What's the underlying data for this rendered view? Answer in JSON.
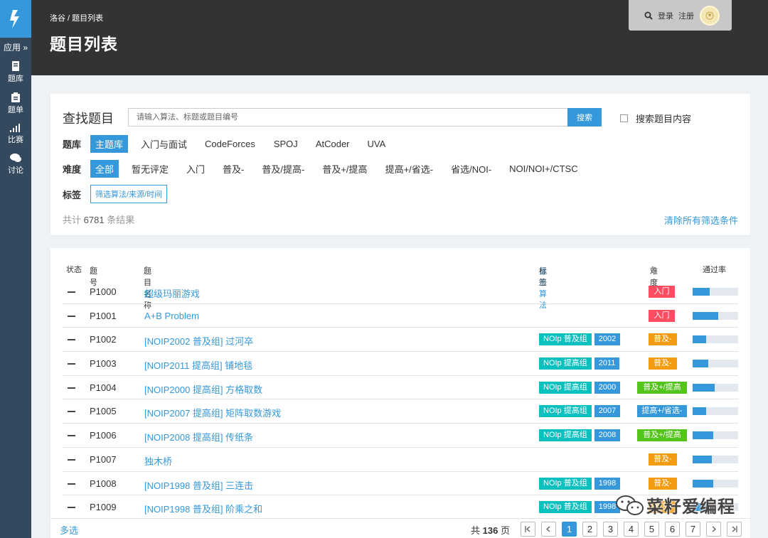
{
  "sidebar": {
    "app_label": "应用 »",
    "items": [
      {
        "label": "题库",
        "icon": "book-icon"
      },
      {
        "label": "题单",
        "icon": "clipboard-icon"
      },
      {
        "label": "比赛",
        "icon": "signal-icon"
      },
      {
        "label": "讨论",
        "icon": "chat-icon"
      }
    ]
  },
  "header": {
    "breadcrumb": "洛谷 / 题目列表",
    "title": "题目列表",
    "login": "登录",
    "register": "注册"
  },
  "search": {
    "label": "查找题目",
    "placeholder": "请输入算法、标题或题目编号",
    "button": "搜索",
    "content_option": "搜索题目内容"
  },
  "filters": {
    "bank_title": "题库",
    "banks": [
      "主题库",
      "入门与面试",
      "CodeForces",
      "SPOJ",
      "AtCoder",
      "UVA"
    ],
    "difficulty_title": "难度",
    "difficulties": [
      "全部",
      "暂无评定",
      "入门",
      "普及-",
      "普及/提高-",
      "普及+/提高",
      "提高+/省选-",
      "省选/NOI-",
      "NOI/NOI+/CTSC"
    ],
    "tag_title": "标签",
    "tag_button": "筛选算法/来源/时间",
    "result_prefix": "共计",
    "result_count": "6781",
    "result_suffix": "条结果",
    "clear": "清除所有筛选条件"
  },
  "table": {
    "headers": {
      "status": "状态",
      "pid": "题号",
      "title": "题目名称",
      "show_algo": "显示算法",
      "tags": "标签",
      "difficulty": "难度",
      "pass_rate": "通过率"
    },
    "rows": [
      {
        "pid": "P1000",
        "title": "超级玛丽游戏",
        "tags": [],
        "difficulty": "入门",
        "diff_color": "#fe4c61",
        "pass": 0.38
      },
      {
        "pid": "P1001",
        "title": "A+B Problem",
        "tags": [],
        "difficulty": "入门",
        "diff_color": "#fe4c61",
        "pass": 0.56
      },
      {
        "pid": "P1002",
        "title": "[NOIP2002 普及组] 过河卒",
        "tags": [
          "NOIp 普及组",
          "2002"
        ],
        "difficulty": "普及-",
        "diff_color": "#f39c11",
        "pass": 0.3
      },
      {
        "pid": "P1003",
        "title": "[NOIP2011 提高组] 铺地毯",
        "tags": [
          "NOIp 提高组",
          "2011"
        ],
        "difficulty": "普及-",
        "diff_color": "#f39c11",
        "pass": 0.35
      },
      {
        "pid": "P1004",
        "title": "[NOIP2000 提高组] 方格取数",
        "tags": [
          "NOIp 提高组",
          "2000"
        ],
        "difficulty": "普及+/提高",
        "diff_color": "#52c41a",
        "pass": 0.48
      },
      {
        "pid": "P1005",
        "title": "[NOIP2007 提高组] 矩阵取数游戏",
        "tags": [
          "NOIp 提高组",
          "2007"
        ],
        "difficulty": "提高+/省选-",
        "diff_color": "#3498db",
        "pass": 0.3
      },
      {
        "pid": "P1006",
        "title": "[NOIP2008 提高组] 传纸条",
        "tags": [
          "NOIp 提高组",
          "2008"
        ],
        "difficulty": "普及+/提高",
        "diff_color": "#52c41a",
        "pass": 0.45
      },
      {
        "pid": "P1007",
        "title": "独木桥",
        "tags": [],
        "difficulty": "普及-",
        "diff_color": "#f39c11",
        "pass": 0.42
      },
      {
        "pid": "P1008",
        "title": "[NOIP1998 普及组] 三连击",
        "tags": [
          "NOIp 普及组",
          "1998"
        ],
        "difficulty": "普及-",
        "diff_color": "#f39c11",
        "pass": 0.45
      },
      {
        "pid": "P1009",
        "title": "[NOIP1998 普及组] 阶乘之和",
        "tags": [
          "NOIp 普及组",
          "1998"
        ],
        "difficulty": "普及-",
        "diff_color": "#f39c11",
        "pass": 0.3
      }
    ]
  },
  "footer": {
    "multi_select": "多选",
    "total_prefix": "共",
    "total_pages": "136",
    "total_suffix": "页",
    "pages": [
      "1",
      "2",
      "3",
      "4",
      "5",
      "6",
      "7"
    ],
    "active_page": "1"
  },
  "watermark": "菜籽爱编程",
  "colors": {
    "accent": "#3498db",
    "sidebar": "#34495e",
    "header": "#333333"
  }
}
